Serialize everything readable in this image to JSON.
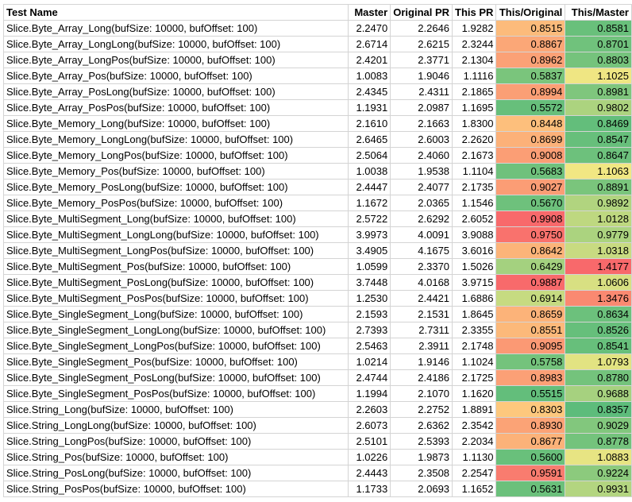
{
  "headers": [
    "Test Name",
    "Master",
    "Original PR",
    "This PR",
    "This/Original",
    "This/Master"
  ],
  "rows": [
    [
      "Slice.Byte_Array_Long(bufSize: 10000, bufOffset: 100)",
      "2.2470",
      "2.2646",
      "1.9282",
      "0.8515",
      "0.8581"
    ],
    [
      "Slice.Byte_Array_LongLong(bufSize: 10000, bufOffset: 100)",
      "2.6714",
      "2.6215",
      "2.3244",
      "0.8867",
      "0.8701"
    ],
    [
      "Slice.Byte_Array_LongPos(bufSize: 10000, bufOffset: 100)",
      "2.4201",
      "2.3771",
      "2.1304",
      "0.8962",
      "0.8803"
    ],
    [
      "Slice.Byte_Array_Pos(bufSize: 10000, bufOffset: 100)",
      "1.0083",
      "1.9046",
      "1.1116",
      "0.5837",
      "1.1025"
    ],
    [
      "Slice.Byte_Array_PosLong(bufSize: 10000, bufOffset: 100)",
      "2.4345",
      "2.4311",
      "2.1865",
      "0.8994",
      "0.8981"
    ],
    [
      "Slice.Byte_Array_PosPos(bufSize: 10000, bufOffset: 100)",
      "1.1931",
      "2.0987",
      "1.1695",
      "0.5572",
      "0.9802"
    ],
    [
      "Slice.Byte_Memory_Long(bufSize: 10000, bufOffset: 100)",
      "2.1610",
      "2.1663",
      "1.8300",
      "0.8448",
      "0.8469"
    ],
    [
      "Slice.Byte_Memory_LongLong(bufSize: 10000, bufOffset: 100)",
      "2.6465",
      "2.6003",
      "2.2620",
      "0.8699",
      "0.8547"
    ],
    [
      "Slice.Byte_Memory_LongPos(bufSize: 10000, bufOffset: 100)",
      "2.5064",
      "2.4060",
      "2.1673",
      "0.9008",
      "0.8647"
    ],
    [
      "Slice.Byte_Memory_Pos(bufSize: 10000, bufOffset: 100)",
      "1.0038",
      "1.9538",
      "1.1104",
      "0.5683",
      "1.1063"
    ],
    [
      "Slice.Byte_Memory_PosLong(bufSize: 10000, bufOffset: 100)",
      "2.4447",
      "2.4077",
      "2.1735",
      "0.9027",
      "0.8891"
    ],
    [
      "Slice.Byte_Memory_PosPos(bufSize: 10000, bufOffset: 100)",
      "1.1672",
      "2.0365",
      "1.1546",
      "0.5670",
      "0.9892"
    ],
    [
      "Slice.Byte_MultiSegment_Long(bufSize: 10000, bufOffset: 100)",
      "2.5722",
      "2.6292",
      "2.6052",
      "0.9908",
      "1.0128"
    ],
    [
      "Slice.Byte_MultiSegment_LongLong(bufSize: 10000, bufOffset: 100)",
      "3.9973",
      "4.0091",
      "3.9088",
      "0.9750",
      "0.9779"
    ],
    [
      "Slice.Byte_MultiSegment_LongPos(bufSize: 10000, bufOffset: 100)",
      "3.4905",
      "4.1675",
      "3.6016",
      "0.8642",
      "1.0318"
    ],
    [
      "Slice.Byte_MultiSegment_Pos(bufSize: 10000, bufOffset: 100)",
      "1.0599",
      "2.3370",
      "1.5026",
      "0.6429",
      "1.4177"
    ],
    [
      "Slice.Byte_MultiSegment_PosLong(bufSize: 10000, bufOffset: 100)",
      "3.7448",
      "4.0168",
      "3.9715",
      "0.9887",
      "1.0606"
    ],
    [
      "Slice.Byte_MultiSegment_PosPos(bufSize: 10000, bufOffset: 100)",
      "1.2530",
      "2.4421",
      "1.6886",
      "0.6914",
      "1.3476"
    ],
    [
      "Slice.Byte_SingleSegment_Long(bufSize: 10000, bufOffset: 100)",
      "2.1593",
      "2.1531",
      "1.8645",
      "0.8659",
      "0.8634"
    ],
    [
      "Slice.Byte_SingleSegment_LongLong(bufSize: 10000, bufOffset: 100)",
      "2.7393",
      "2.7311",
      "2.3355",
      "0.8551",
      "0.8526"
    ],
    [
      "Slice.Byte_SingleSegment_LongPos(bufSize: 10000, bufOffset: 100)",
      "2.5463",
      "2.3911",
      "2.1748",
      "0.9095",
      "0.8541"
    ],
    [
      "Slice.Byte_SingleSegment_Pos(bufSize: 10000, bufOffset: 100)",
      "1.0214",
      "1.9146",
      "1.1024",
      "0.5758",
      "1.0793"
    ],
    [
      "Slice.Byte_SingleSegment_PosLong(bufSize: 10000, bufOffset: 100)",
      "2.4744",
      "2.4186",
      "2.1725",
      "0.8983",
      "0.8780"
    ],
    [
      "Slice.Byte_SingleSegment_PosPos(bufSize: 10000, bufOffset: 100)",
      "1.1994",
      "2.1070",
      "1.1620",
      "0.5515",
      "0.9688"
    ],
    [
      "Slice.String_Long(bufSize: 10000, bufOffset: 100)",
      "2.2603",
      "2.2752",
      "1.8891",
      "0.8303",
      "0.8357"
    ],
    [
      "Slice.String_LongLong(bufSize: 10000, bufOffset: 100)",
      "2.6073",
      "2.6362",
      "2.3542",
      "0.8930",
      "0.9029"
    ],
    [
      "Slice.String_LongPos(bufSize: 10000, bufOffset: 100)",
      "2.5101",
      "2.5393",
      "2.2034",
      "0.8677",
      "0.8778"
    ],
    [
      "Slice.String_Pos(bufSize: 10000, bufOffset: 100)",
      "1.0226",
      "1.9873",
      "1.1130",
      "0.5600",
      "1.0883"
    ],
    [
      "Slice.String_PosLong(bufSize: 10000, bufOffset: 100)",
      "2.4443",
      "2.3508",
      "2.2547",
      "0.9591",
      "0.9224"
    ],
    [
      "Slice.String_PosPos(bufSize: 10000, bufOffset: 100)",
      "1.1733",
      "2.0693",
      "1.1652",
      "0.5631",
      "0.9931"
    ]
  ],
  "color_scale": {
    "low": "#63be7b",
    "mid": "#ffeb84",
    "high": "#f8696b",
    "this_original_range": [
      0.5515,
      0.9908
    ],
    "this_master_range": [
      0.8469,
      1.4177
    ]
  }
}
